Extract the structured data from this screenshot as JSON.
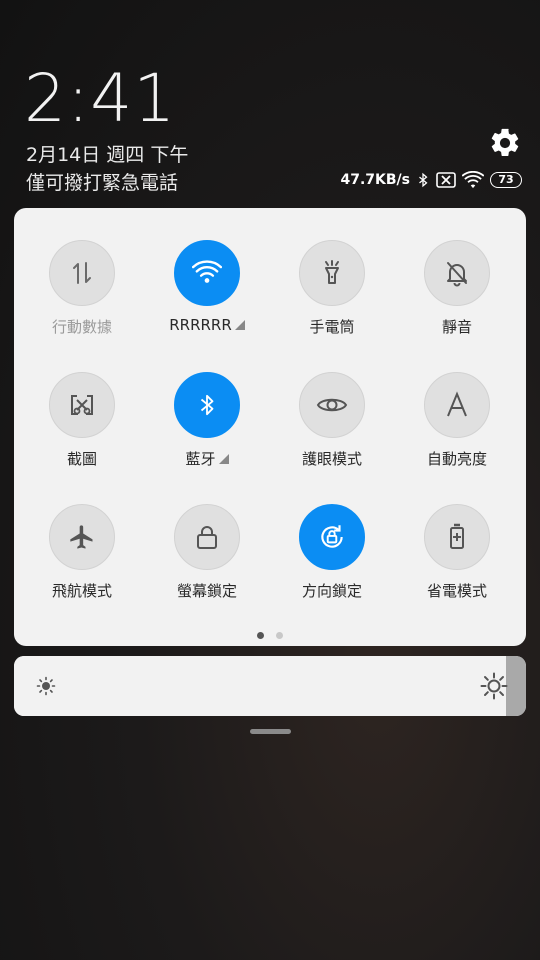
{
  "lockscreen": {
    "time": "2:41",
    "date": "2月14日 週四 下午",
    "emergency_text": "僅可撥打緊急電話"
  },
  "status_bar": {
    "network_speed": "47.7KB/s",
    "battery_level": "73",
    "icons": [
      "bluetooth-icon",
      "no-sim-icon",
      "wifi-icon",
      "battery-icon"
    ]
  },
  "tiles": [
    {
      "id": "mobile-data",
      "label": "行動數據",
      "icon": "mobile-data-icon",
      "on": false,
      "dim": true
    },
    {
      "id": "wifi",
      "label": "RRRRRR",
      "icon": "wifi-icon",
      "on": true,
      "expand": true
    },
    {
      "id": "flashlight",
      "label": "手電筒",
      "icon": "flashlight-icon",
      "on": false
    },
    {
      "id": "silent",
      "label": "靜音",
      "icon": "bell-off-icon",
      "on": false
    },
    {
      "id": "screenshot",
      "label": "截圖",
      "icon": "screenshot-icon",
      "on": false
    },
    {
      "id": "bluetooth",
      "label": "藍牙",
      "icon": "bluetooth-icon",
      "on": true,
      "expand": true
    },
    {
      "id": "eye-care",
      "label": "護眼模式",
      "icon": "eye-icon",
      "on": false
    },
    {
      "id": "auto-brightness",
      "label": "自動亮度",
      "icon": "letter-a-icon",
      "on": false
    },
    {
      "id": "airplane",
      "label": "飛航模式",
      "icon": "airplane-icon",
      "on": false
    },
    {
      "id": "screen-lock",
      "label": "螢幕鎖定",
      "icon": "lock-icon",
      "on": false
    },
    {
      "id": "rotation-lock",
      "label": "方向鎖定",
      "icon": "rotation-lock-icon",
      "on": true
    },
    {
      "id": "battery-saver",
      "label": "省電模式",
      "icon": "battery-saver-icon",
      "on": false
    }
  ],
  "pager": {
    "pages": 2,
    "current": 1
  },
  "brightness": {
    "level": 0.96
  },
  "colors": {
    "accent": "#0b8df3",
    "panel": "#f2f2f2"
  }
}
